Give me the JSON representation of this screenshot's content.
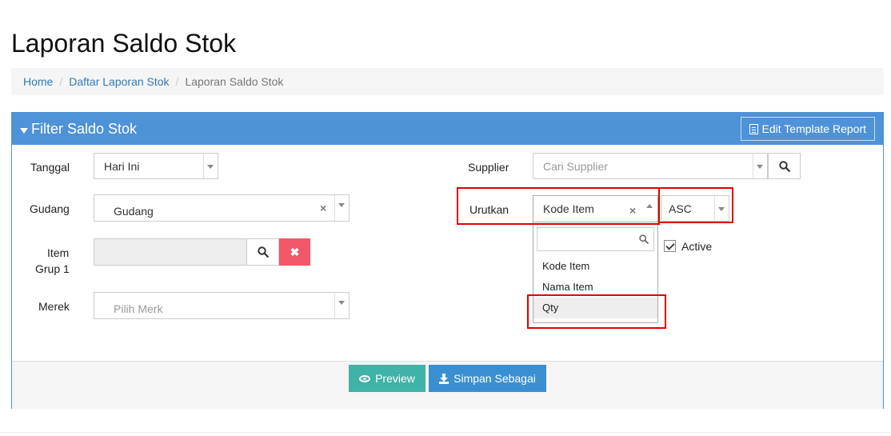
{
  "page": {
    "title": "Laporan Saldo Stok"
  },
  "breadcrumb": {
    "home": "Home",
    "parent": "Daftar Laporan Stok",
    "current": "Laporan Saldo Stok",
    "sep": "/"
  },
  "panel": {
    "title": "Filter Saldo Stok",
    "edit_template": "Edit Template Report"
  },
  "filters": {
    "tanggal": {
      "label": "Tanggal",
      "value": "Hari Ini"
    },
    "gudang": {
      "label": "Gudang",
      "value": "Gudang",
      "clear": "×"
    },
    "item_grup": {
      "label_line1": "Item",
      "label_line2": "Grup 1",
      "clear": "✖"
    },
    "merek": {
      "label": "Merek",
      "placeholder": "Pilih Merk"
    },
    "supplier": {
      "label": "Supplier",
      "placeholder": "Cari Supplier"
    },
    "urutkan": {
      "label": "Urutkan",
      "value": "Kode Item",
      "clear": "×",
      "direction": "ASC"
    },
    "active": {
      "label": "Active",
      "checked": true
    }
  },
  "dropdown": {
    "options": [
      "Kode Item",
      "Nama Item",
      "Qty"
    ],
    "highlighted": "Qty"
  },
  "footer": {
    "preview": "Preview",
    "save_as": "Simpan Sebagai"
  },
  "colors": {
    "primary": "#4e92d8",
    "preview": "#3fb3a8",
    "save": "#3a8fd1",
    "danger": "#f25767",
    "highlight": "#e00000"
  }
}
